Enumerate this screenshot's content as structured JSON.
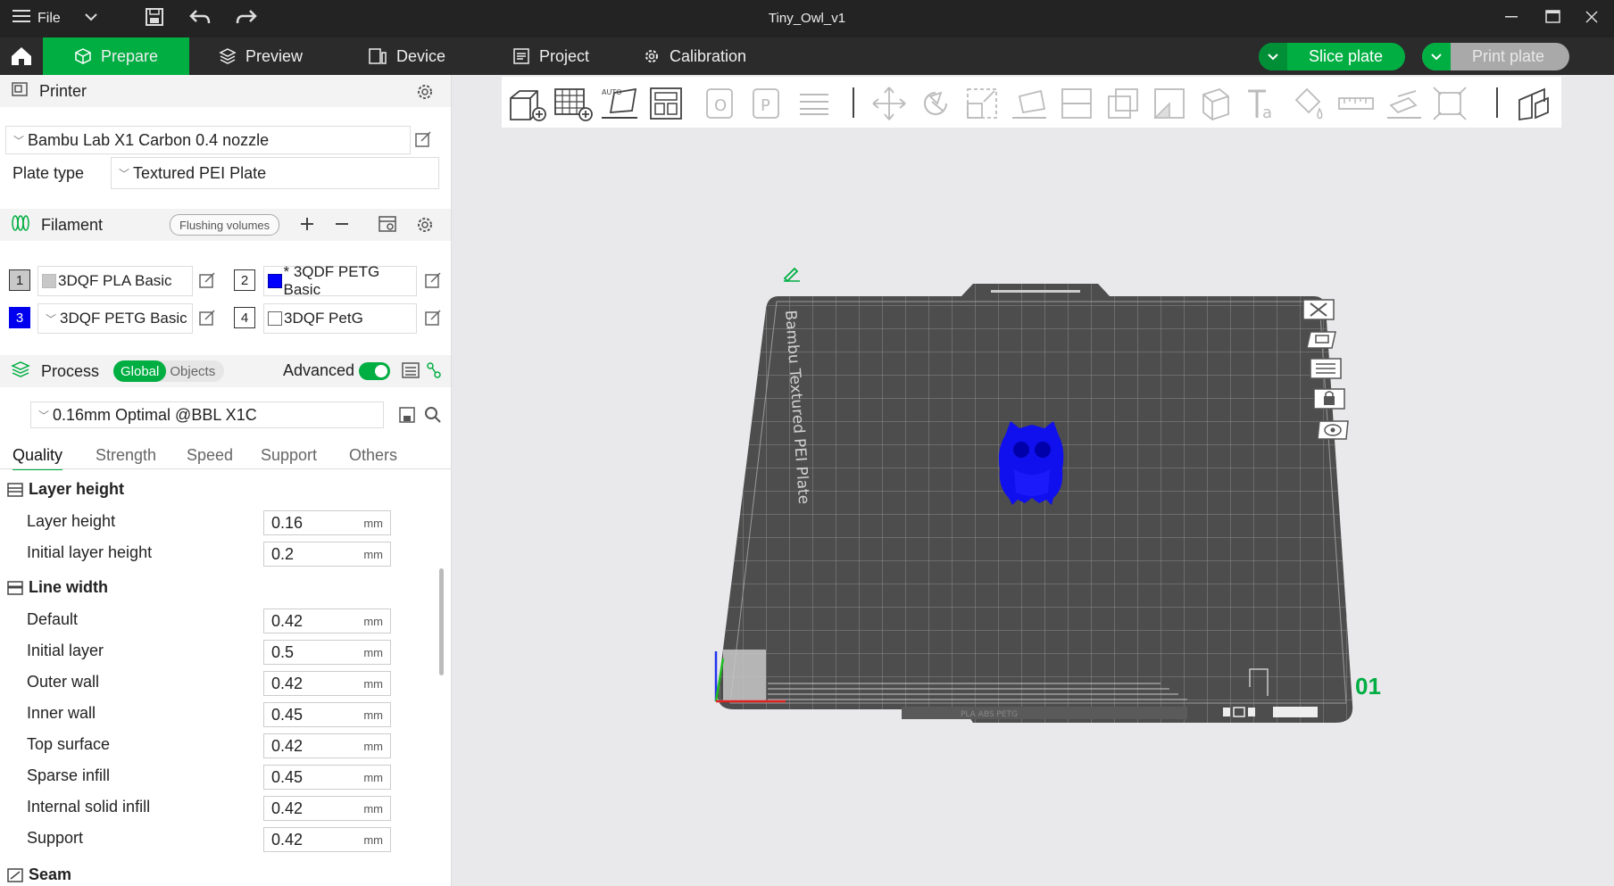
{
  "window": {
    "title": "Tiny_Owl_v1",
    "file_menu": "File"
  },
  "nav": {
    "tabs": [
      {
        "label": "Prepare"
      },
      {
        "label": "Preview"
      },
      {
        "label": "Device"
      },
      {
        "label": "Project"
      },
      {
        "label": "Calibration"
      }
    ],
    "slice_button": "Slice plate",
    "print_button": "Print plate"
  },
  "printer": {
    "section_title": "Printer",
    "selected": "Bambu Lab X1 Carbon 0.4 nozzle",
    "plate_type_label": "Plate type",
    "plate_type_value": "Textured PEI Plate"
  },
  "filament": {
    "section_title": "Filament",
    "flushing_button": "Flushing volumes",
    "items": [
      {
        "num": "1",
        "name": "3DQF PLA Basic",
        "color": "#c8c8c8"
      },
      {
        "num": "2",
        "name": "* 3QDF PETG Basic",
        "color": "#0000ff"
      },
      {
        "num": "3",
        "name": "3DQF PETG Basic",
        "color": "#0000ee"
      },
      {
        "num": "4",
        "name": "3DQF PetG",
        "color": "#ffffff"
      }
    ]
  },
  "process": {
    "section_title": "Process",
    "global_label": "Global",
    "objects_label": "Objects",
    "advanced_label": "Advanced",
    "preset": "0.16mm Optimal @BBL X1C",
    "tabs": [
      "Quality",
      "Strength",
      "Speed",
      "Support",
      "Others"
    ],
    "groups": {
      "layer_height": {
        "title": "Layer height",
        "rows": [
          {
            "label": "Layer height",
            "value": "0.16",
            "unit": "mm"
          },
          {
            "label": "Initial layer height",
            "value": "0.2",
            "unit": "mm"
          }
        ]
      },
      "line_width": {
        "title": "Line width",
        "rows": [
          {
            "label": "Default",
            "value": "0.42",
            "unit": "mm"
          },
          {
            "label": "Initial layer",
            "value": "0.5",
            "unit": "mm"
          },
          {
            "label": "Outer wall",
            "value": "0.42",
            "unit": "mm"
          },
          {
            "label": "Inner wall",
            "value": "0.45",
            "unit": "mm"
          },
          {
            "label": "Top surface",
            "value": "0.42",
            "unit": "mm"
          },
          {
            "label": "Sparse infill",
            "value": "0.45",
            "unit": "mm"
          },
          {
            "label": "Internal solid infill",
            "value": "0.42",
            "unit": "mm"
          },
          {
            "label": "Support",
            "value": "0.42",
            "unit": "mm"
          }
        ]
      },
      "seam": {
        "title": "Seam"
      }
    }
  },
  "viewport": {
    "plate_text": "Bambu Textured PEI Plate",
    "plate_number": "01",
    "bottom_strip_text": "PLA ABS PETG",
    "model_color": "#1010ee",
    "accent": "#00ae42"
  }
}
